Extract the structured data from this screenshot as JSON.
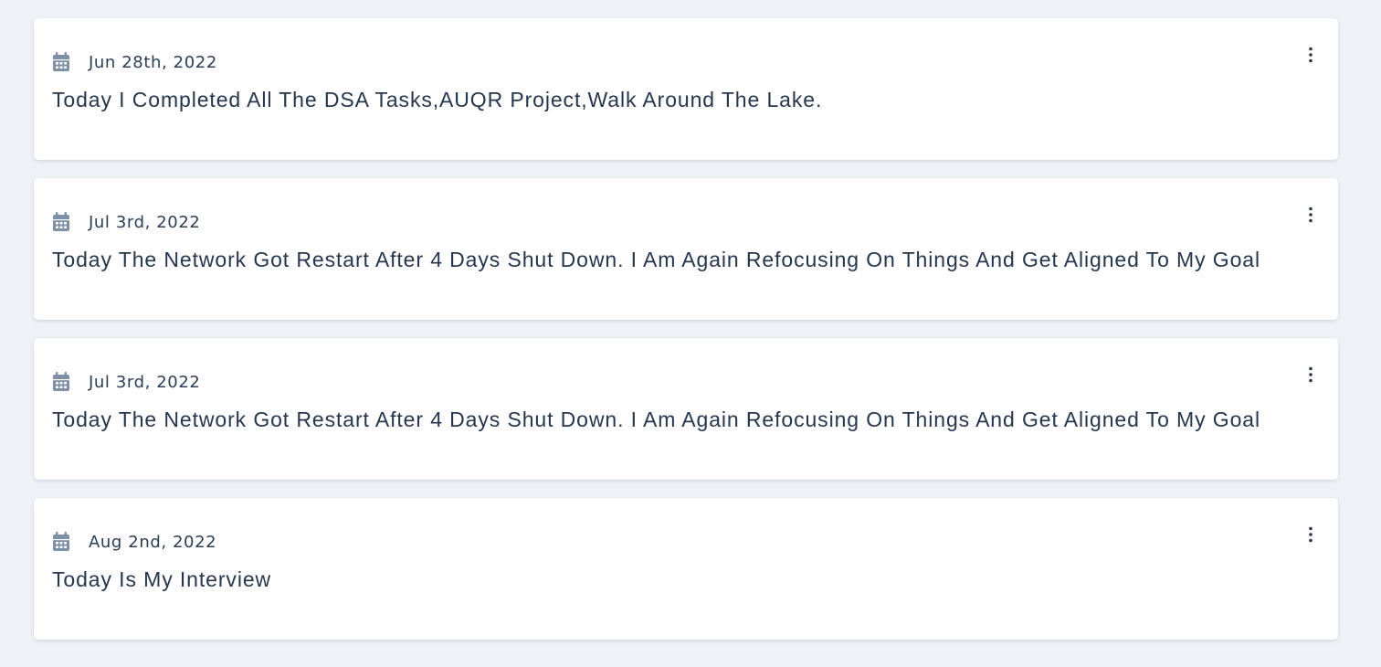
{
  "colors": {
    "background": "#eef2f7",
    "card": "#ffffff",
    "calendar_icon": "#7f8fa6",
    "text": "#26364d"
  },
  "icons": {
    "date": "calendar-icon",
    "menu": "more-vertical-icon"
  },
  "entries": [
    {
      "date": "Jun 28th, 2022",
      "text": "Today I Completed All The DSA Tasks,AUQR Project,Walk Around The Lake."
    },
    {
      "date": "Jul 3rd, 2022",
      "text": "Today The Network Got Restart After 4 Days Shut Down. I Am Again Refocusing On Things And Get Aligned To My Goal"
    },
    {
      "date": "Jul 3rd, 2022",
      "text": "Today The Network Got Restart After 4 Days Shut Down. I Am Again Refocusing On Things And Get Aligned To My Goal"
    },
    {
      "date": "Aug 2nd, 2022",
      "text": "Today Is My Interview"
    }
  ]
}
